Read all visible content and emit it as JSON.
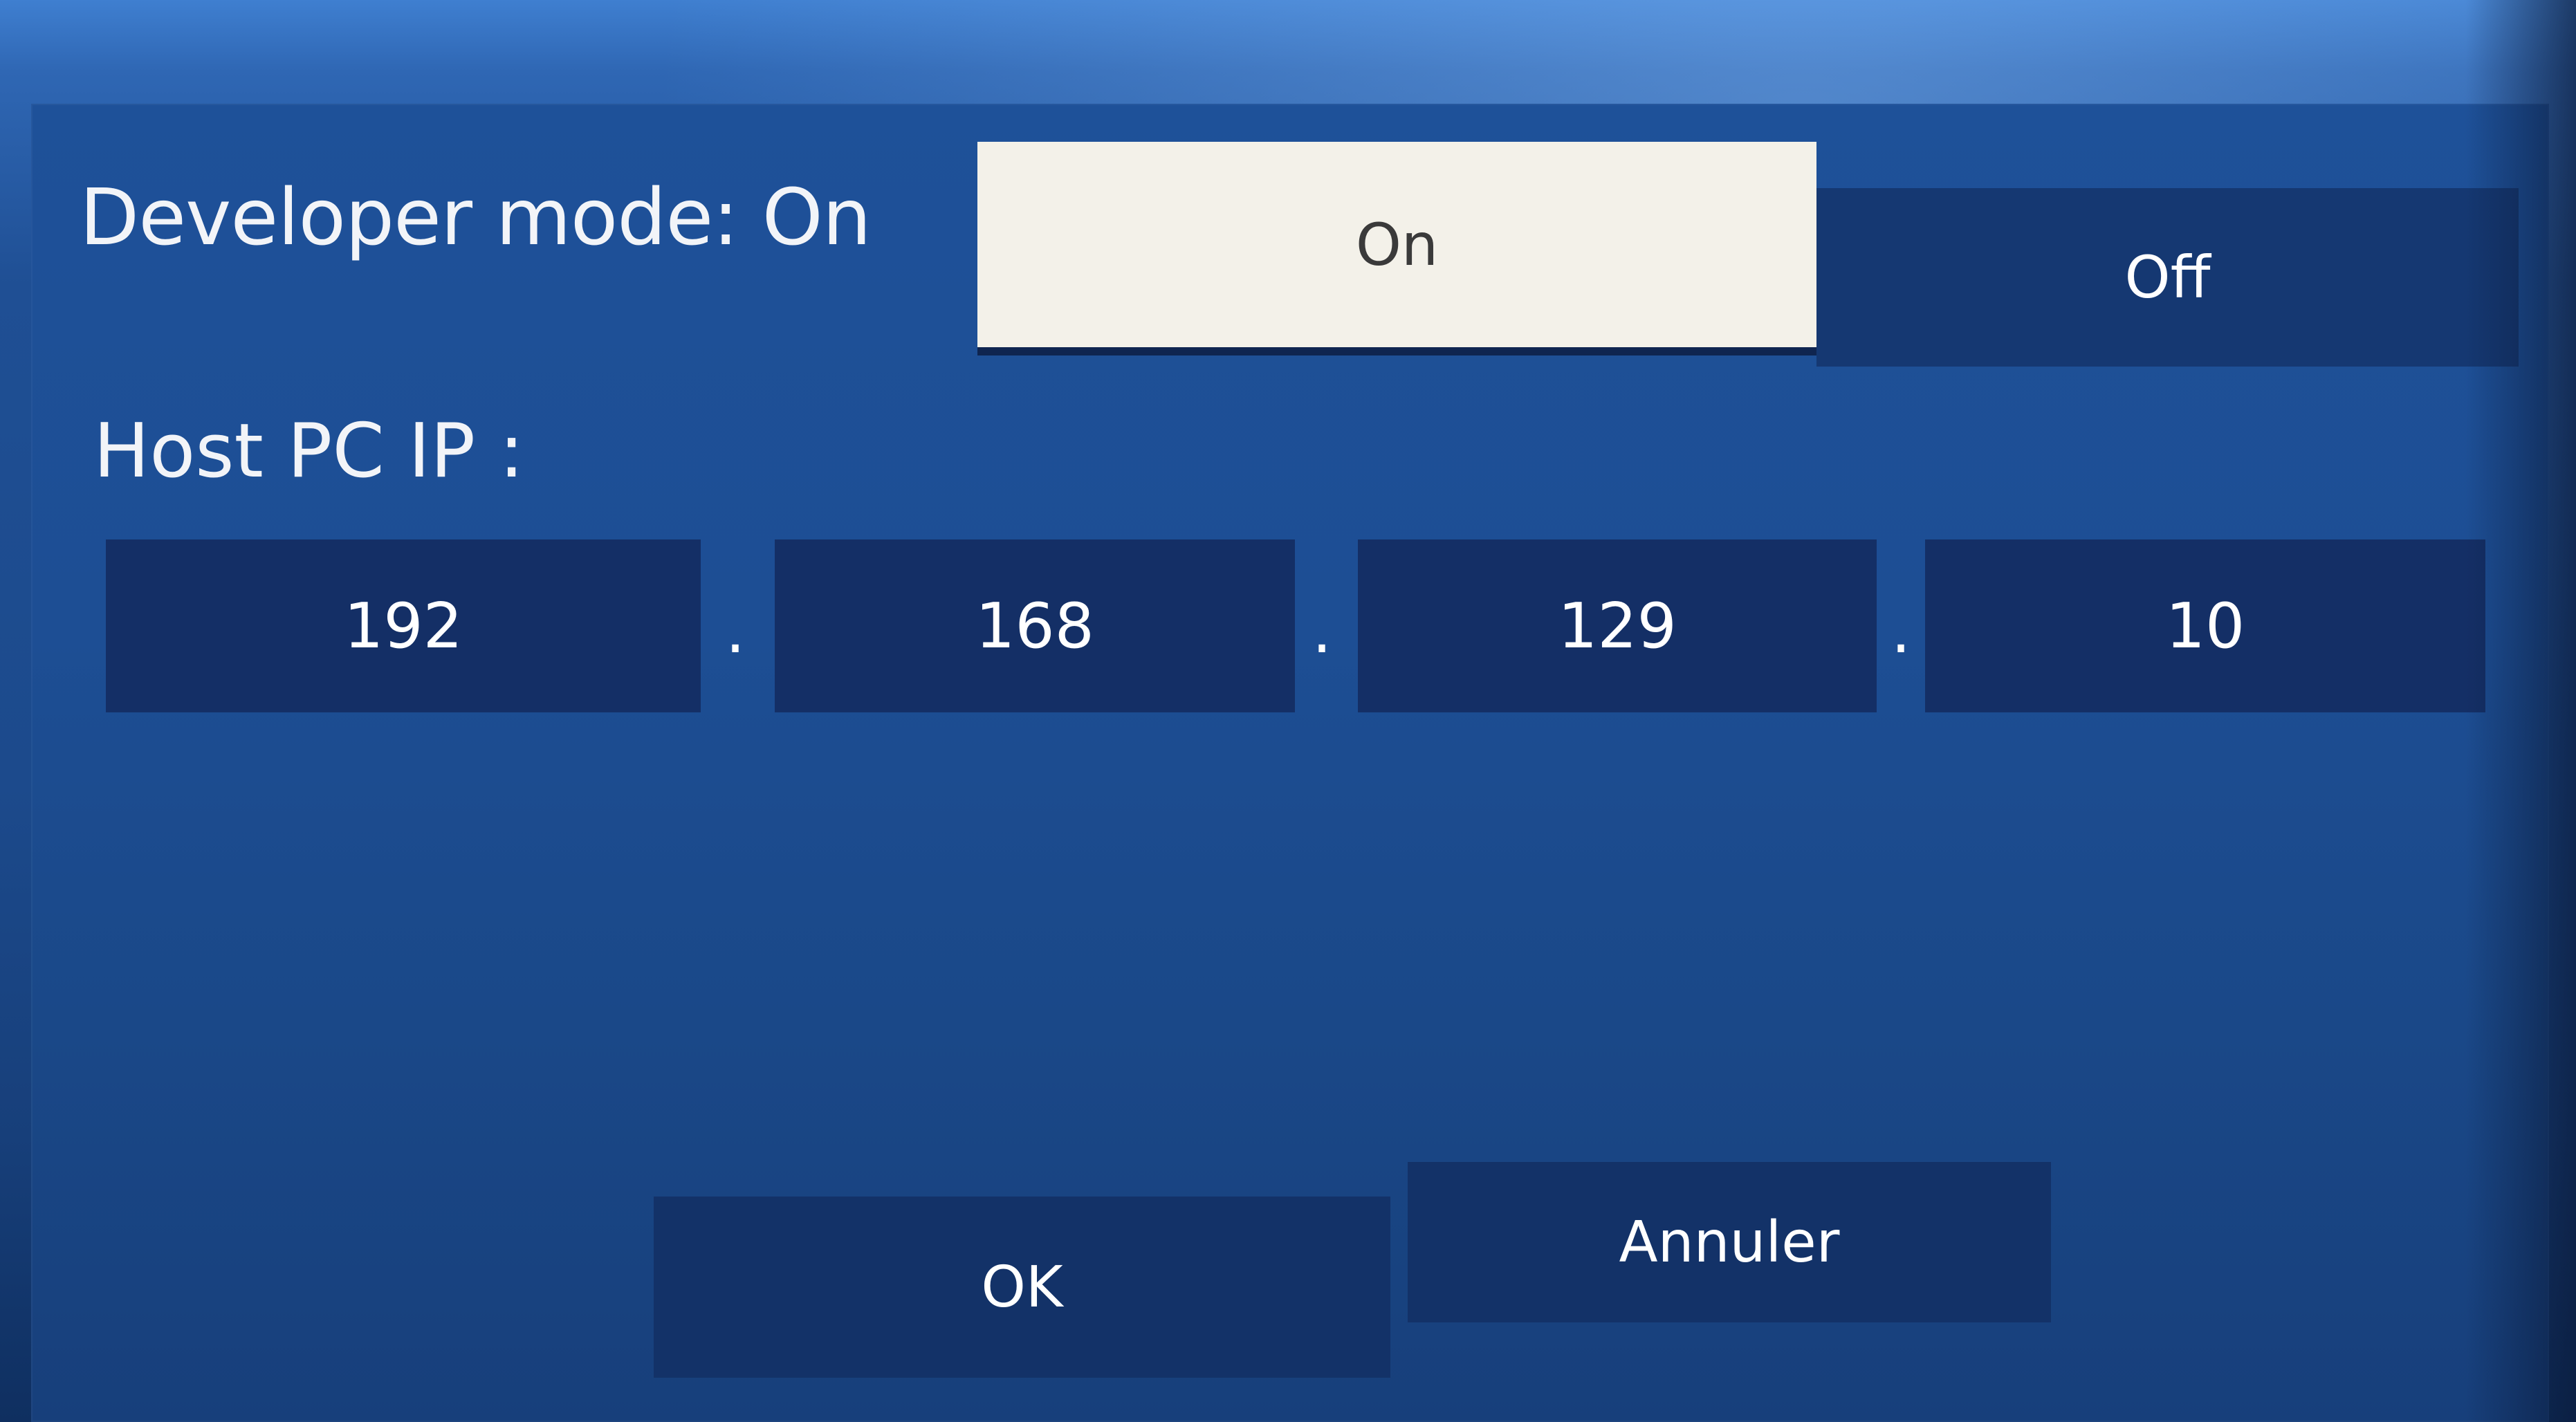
{
  "developer_mode": {
    "label": "Developer mode: On",
    "options": [
      {
        "label": "On",
        "selected": true
      },
      {
        "label": "Off",
        "selected": false
      }
    ]
  },
  "host_pc_ip": {
    "label": "Host PC IP :",
    "octets": [
      "192",
      "168",
      "129",
      "10"
    ],
    "separator": "."
  },
  "buttons": {
    "ok": "OK",
    "cancel": "Annuler"
  },
  "colors": {
    "selected_option_bg": "#f3f1e9",
    "field_bg": "#142f66",
    "dialog_bg": "#1d4e94"
  }
}
